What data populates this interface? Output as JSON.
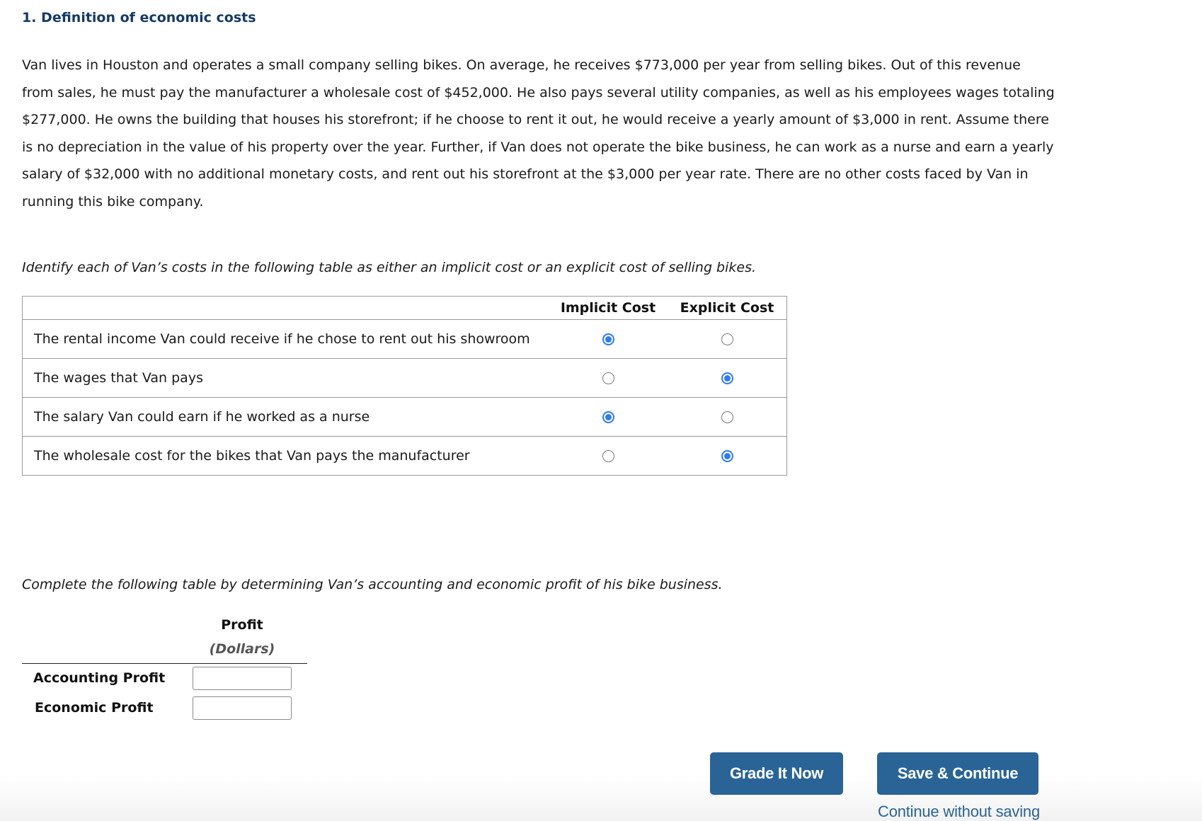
{
  "question": {
    "title": "1. Definition of economic costs",
    "paragraph": "Van lives in Houston and operates a small company selling bikes. On average, he receives $773,000 per year from selling bikes. Out of this revenue from sales, he must pay the manufacturer a wholesale cost of $452,000. He also pays several utility companies, as well as his employees wages totaling $277,000. He owns the building that houses his storefront; if he choose to rent it out, he would receive a yearly amount of $3,000 in rent. Assume there is no depreciation in the value of his property over the year. Further, if Van does not operate the bike business, he can work as a nurse and earn a yearly salary of $32,000 with no additional monetary costs, and rent out his storefront at the $3,000 per year rate. There are no other costs faced by Van in running this bike company."
  },
  "cost_table": {
    "prompt": "Identify each of Van’s costs in the following table as either an implicit cost or an explicit cost of selling bikes.",
    "columns": [
      "Implicit Cost",
      "Explicit Cost"
    ],
    "rows": [
      {
        "label": "The rental income Van could receive if he chose to rent out his showroom",
        "selected": "Implicit Cost"
      },
      {
        "label": "The wages that Van pays",
        "selected": "Explicit Cost"
      },
      {
        "label": "The salary Van could earn if he worked as a nurse",
        "selected": "Implicit Cost"
      },
      {
        "label": "The wholesale cost for the bikes that Van pays the manufacturer",
        "selected": "Explicit Cost"
      }
    ]
  },
  "profit_table": {
    "prompt": "Complete the following table by determining Van’s accounting and economic profit of his bike business.",
    "header": "Profit",
    "subheader": "(Dollars)",
    "rows": [
      {
        "label": "Accounting Profit",
        "value": ""
      },
      {
        "label": "Economic Profit",
        "value": ""
      }
    ]
  },
  "actions": {
    "grade_label": "Grade It Now",
    "save_label": "Save & Continue",
    "continue_link": "Continue without saving"
  },
  "colors": {
    "title": "#163a66",
    "button": "#2a6496",
    "radio_selected": "#2f7bf5"
  }
}
